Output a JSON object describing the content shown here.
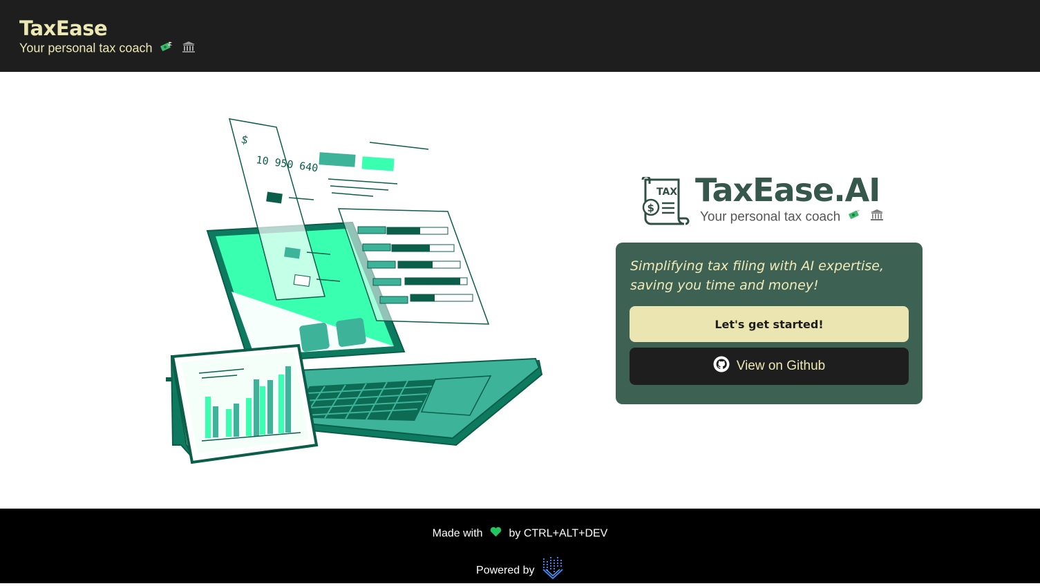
{
  "header": {
    "title": "TaxEase",
    "subtitle": "Your personal tax coach",
    "emoji_icons": [
      "money-with-wings-icon",
      "bank-icon"
    ]
  },
  "hero": {
    "illustration": {
      "receipt_currency": "$",
      "receipt_amount": "10 950 640"
    },
    "logo": {
      "badge_text": "TAX",
      "badge_symbol": "$",
      "title": "TaxEase.AI",
      "subtitle": "Your personal tax coach"
    },
    "card": {
      "tagline": "Simplifying tax filing with AI expertise, saving you time and money!",
      "start_button": "Let's get started!",
      "github_button": "View on Github"
    }
  },
  "footer": {
    "made_with_prefix": "Made with",
    "made_with_suffix": "by CTRL+ALT+DEV",
    "powered_by": "Powered by"
  },
  "colors": {
    "header_bg": "#1e1e1e",
    "brand_yellow": "#ece8b3",
    "card_bg": "#3d6254",
    "logo_green": "#36574b",
    "accent_mint": "#39ffb0",
    "accent_teal": "#3db39a",
    "footer_bg": "#000000"
  }
}
